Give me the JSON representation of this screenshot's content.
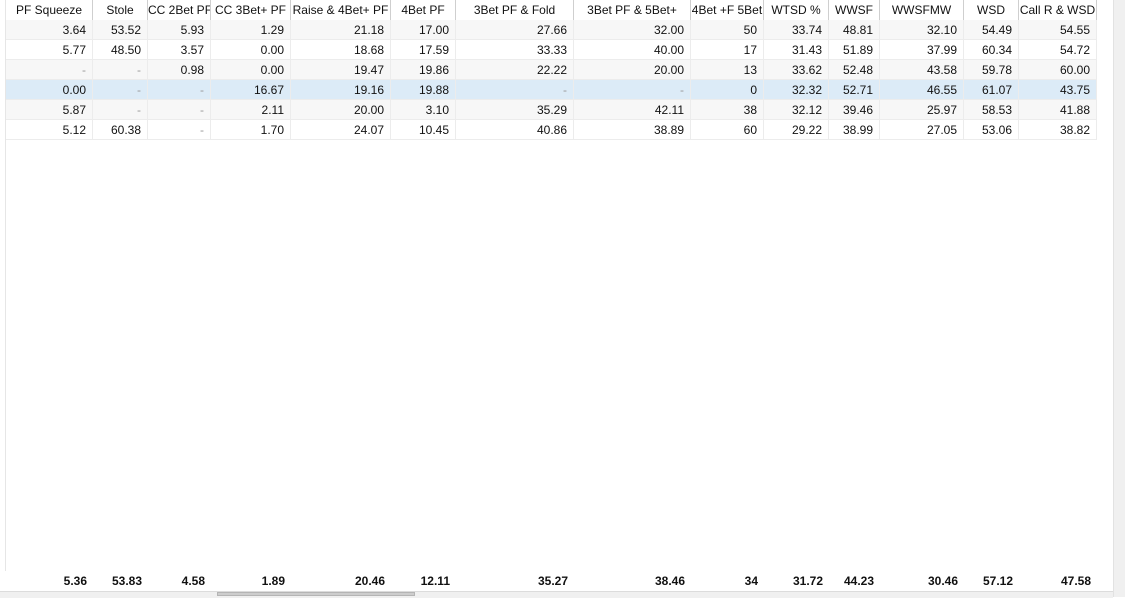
{
  "columns": [
    "PF Squeeze",
    "Stole",
    "CC 2Bet PF",
    "CC 3Bet+ PF",
    "Raise & 4Bet+ PF",
    "4Bet PF",
    "3Bet PF & Fold",
    "3Bet PF & 5Bet+",
    "4Bet +F 5Bet",
    "WTSD %",
    "WWSF",
    "WWSFMW",
    "WSD",
    "Call R & WSD"
  ],
  "rows": [
    [
      "3.64",
      "53.52",
      "5.93",
      "1.29",
      "21.18",
      "17.00",
      "27.66",
      "32.00",
      "50",
      "33.74",
      "48.81",
      "32.10",
      "54.49",
      "54.55"
    ],
    [
      "5.77",
      "48.50",
      "3.57",
      "0.00",
      "18.68",
      "17.59",
      "33.33",
      "40.00",
      "17",
      "31.43",
      "51.89",
      "37.99",
      "60.34",
      "54.72"
    ],
    [
      "-",
      "-",
      "0.98",
      "0.00",
      "19.47",
      "19.86",
      "22.22",
      "20.00",
      "13",
      "33.62",
      "52.48",
      "43.58",
      "59.78",
      "60.00"
    ],
    [
      "0.00",
      "-",
      "-",
      "16.67",
      "19.16",
      "19.88",
      "-",
      "-",
      "0",
      "32.32",
      "52.71",
      "46.55",
      "61.07",
      "43.75"
    ],
    [
      "5.87",
      "-",
      "-",
      "2.11",
      "20.00",
      "3.10",
      "35.29",
      "42.11",
      "38",
      "32.12",
      "39.46",
      "25.97",
      "58.53",
      "41.88"
    ],
    [
      "5.12",
      "60.38",
      "-",
      "1.70",
      "24.07",
      "10.45",
      "40.86",
      "38.89",
      "60",
      "29.22",
      "38.99",
      "27.05",
      "53.06",
      "38.82"
    ]
  ],
  "selected_row": 3,
  "totals": [
    "5.36",
    "53.83",
    "4.58",
    "1.89",
    "20.46",
    "12.11",
    "35.27",
    "38.46",
    "34",
    "31.72",
    "44.23",
    "30.46",
    "57.12",
    "47.58"
  ]
}
